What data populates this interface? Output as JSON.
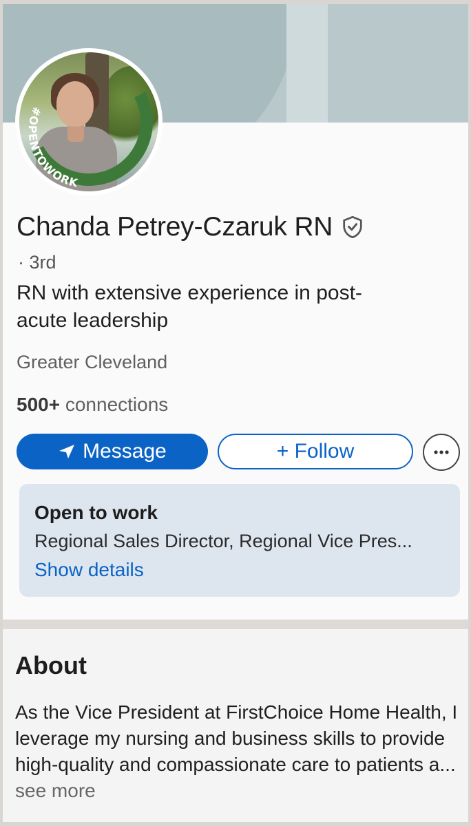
{
  "profile": {
    "name": "Chanda Petrey-Czaruk RN",
    "degree": "· 3rd",
    "headline": "RN with extensive experience in post-acute leadership",
    "location": "Greater Cleveland",
    "connections_count": "500+",
    "connections_label": "connections",
    "avatar_frame_text": "#OPENTOWORK"
  },
  "actions": {
    "message_label": "Message",
    "follow_label": "+ Follow",
    "more_label": "···"
  },
  "open_to_work": {
    "title": "Open to work",
    "roles": "Regional Sales Director, Regional Vice Pres...",
    "link": "Show details"
  },
  "about": {
    "title": "About",
    "text": "As the Vice President at FirstChoice Home Health, I leverage my nursing and business skills to provide high-quality and compassionate care to patients a...",
    "see_more": "see more"
  },
  "colors": {
    "accent": "#0b63c5",
    "open_to_work_frame": "#3d7a3a",
    "card_bg": "#dde5ee"
  }
}
